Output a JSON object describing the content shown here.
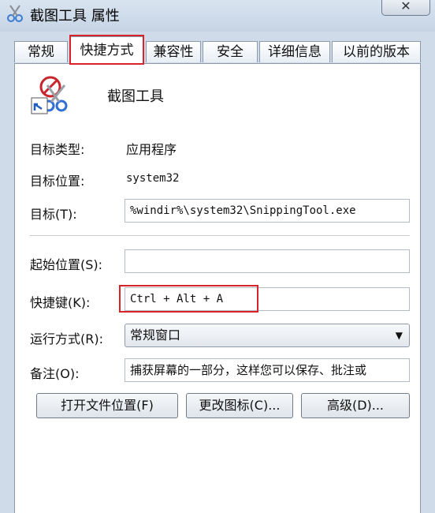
{
  "window": {
    "title": "截图工具 属性",
    "close_label": "✕"
  },
  "tabs": [
    {
      "label": "常规"
    },
    {
      "label": "快捷方式"
    },
    {
      "label": "兼容性"
    },
    {
      "label": "安全"
    },
    {
      "label": "详细信息"
    },
    {
      "label": "以前的版本"
    }
  ],
  "active_tab": "快捷方式",
  "app": {
    "name": "截图工具",
    "icon": "scissors-icon"
  },
  "properties": {
    "target_type_label": "目标类型:",
    "target_type_value": "应用程序",
    "target_location_label": "目标位置:",
    "target_location_value": "system32",
    "target_label": "目标(T):",
    "target_value": "%windir%\\system32\\SnippingTool.exe",
    "start_in_label": "起始位置(S):",
    "start_in_value": "",
    "hotkey_label": "快捷键(K):",
    "hotkey_value": "Ctrl + Alt + A",
    "run_label": "运行方式(R):",
    "run_value": "常规窗口",
    "comment_label": "备注(O):",
    "comment_value": "捕获屏幕的一部分，这样您可以保存、批注或"
  },
  "buttons": {
    "open_location": "打开文件位置(F)",
    "change_icon": "更改图标(C)...",
    "advanced": "高级(D)..."
  },
  "highlight_color": "#d8232a"
}
